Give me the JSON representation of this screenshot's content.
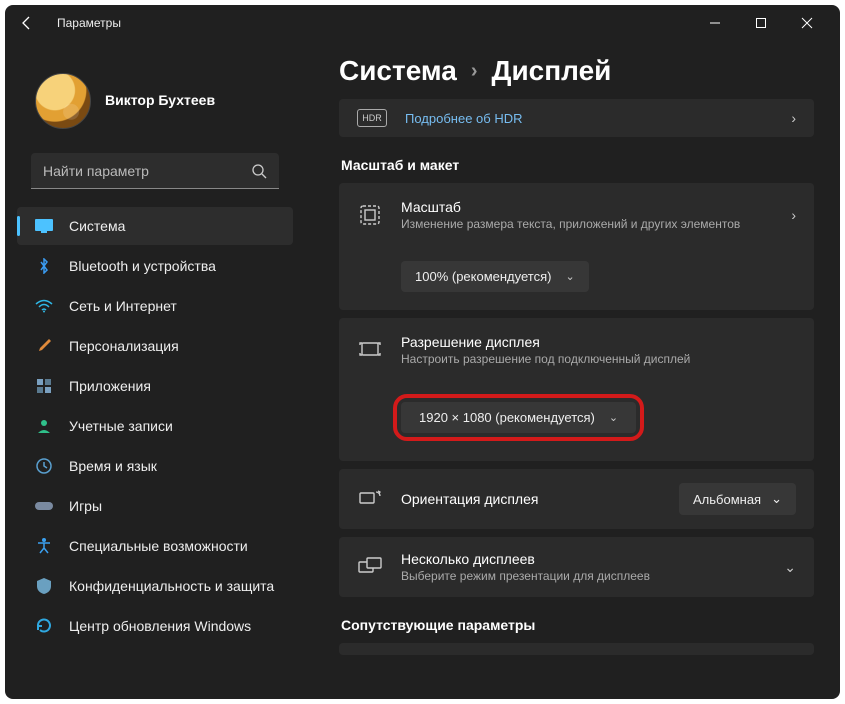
{
  "window": {
    "title": "Параметры"
  },
  "user": {
    "name": "Виктор Бухтеев",
    "sub": ""
  },
  "search": {
    "placeholder": "Найти параметр"
  },
  "nav": [
    {
      "label": "Система",
      "icon": "display-icon",
      "color": "#4cc2ff",
      "selected": true
    },
    {
      "label": "Bluetooth и устройства",
      "icon": "bluetooth-icon",
      "color": "#3a9bf0"
    },
    {
      "label": "Сеть и Интернет",
      "icon": "wifi-icon",
      "color": "#2fb8e6"
    },
    {
      "label": "Персонализация",
      "icon": "brush-icon",
      "color": "#e08a3a"
    },
    {
      "label": "Приложения",
      "icon": "apps-icon",
      "color": "#7aa0c0"
    },
    {
      "label": "Учетные записи",
      "icon": "account-icon",
      "color": "#2fc08a"
    },
    {
      "label": "Время и язык",
      "icon": "clock-icon",
      "color": "#5aa0d0"
    },
    {
      "label": "Игры",
      "icon": "games-icon",
      "color": "#7a8aa0"
    },
    {
      "label": "Специальные возможности",
      "icon": "accessibility-icon",
      "color": "#3aa0f0"
    },
    {
      "label": "Конфиденциальность и защита",
      "icon": "shield-icon",
      "color": "#6aa0c0"
    },
    {
      "label": "Центр обновления Windows",
      "icon": "update-icon",
      "color": "#2fa8e0"
    }
  ],
  "breadcrumb": {
    "part1": "Система",
    "part2": "Дисплей"
  },
  "hdr": {
    "badge": "HDR",
    "link": "Подробнее об HDR"
  },
  "section_scale": "Масштаб и макет",
  "scale": {
    "title": "Масштаб",
    "desc": "Изменение размера текста, приложений и других элементов",
    "value": "100% (рекомендуется)"
  },
  "resolution": {
    "title": "Разрешение дисплея",
    "desc": "Настроить разрешение под подключенный дисплей",
    "value": "1920 × 1080 (рекомендуется)"
  },
  "orientation": {
    "title": "Ориентация дисплея",
    "value": "Альбомная"
  },
  "multi": {
    "title": "Несколько дисплеев",
    "desc": "Выберите режим презентации для дисплеев"
  },
  "section_related": "Сопутствующие параметры"
}
